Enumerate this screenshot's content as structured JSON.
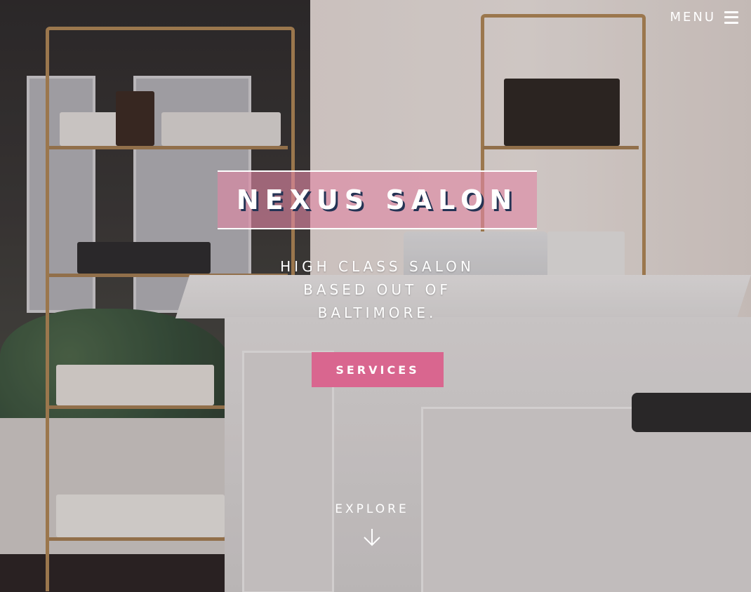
{
  "header": {
    "menu_label": "MENU",
    "menu_icon": "hamburger-icon"
  },
  "hero": {
    "title": "NEXUS SALON",
    "tagline": "HIGH CLASS SALON BASED OUT OF BALTIMORE.",
    "cta_label": "SERVICES",
    "explore_label": "EXPLORE",
    "explore_icon": "arrow-down-icon"
  },
  "colors": {
    "accent_pink": "#d9668f",
    "title_box_pink": "#e187a5",
    "title_shadow": "#243354",
    "text": "#ffffff"
  }
}
